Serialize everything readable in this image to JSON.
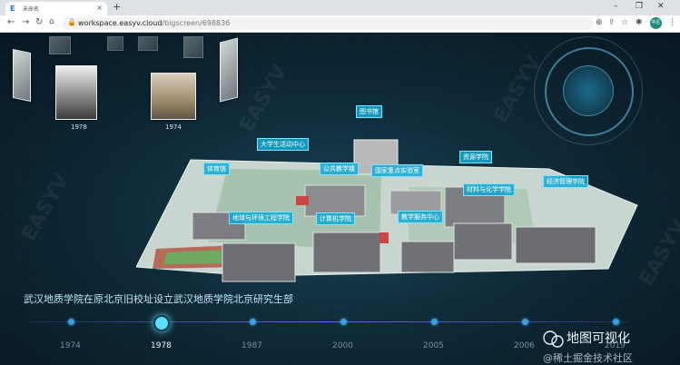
{
  "browser": {
    "tab_title": "未命名",
    "tab_favicon": "E",
    "new_tab": "+",
    "url_host": "workspace.easyv.cloud",
    "url_path": "/bigscreen/698836",
    "avatar_text": "中区"
  },
  "photos": {
    "year_labels": [
      "1978",
      "1974"
    ]
  },
  "campus": {
    "labels": [
      "图书馆",
      "大学生活动中心",
      "体育馆",
      "公共教学楼",
      "国家重点实验室",
      "资源学院",
      "材料与化学学院",
      "经济管理学院",
      "地球与环境工程学院",
      "计算机学院",
      "教学服务中心"
    ]
  },
  "caption": "武汉地质学院在原北京旧校址设立武汉地质学院北京研究生部",
  "timeline": {
    "years": [
      "1974",
      "1978",
      "1987",
      "2000",
      "2005",
      "2006",
      "2019"
    ],
    "active_index": 1
  },
  "watermark": {
    "brand": "EASYV",
    "wechat_title": "地图可视化",
    "community": "@稀土掘金技术社区"
  },
  "colors": {
    "accent": "#57e0ff",
    "label_bg": "#14aad2"
  }
}
